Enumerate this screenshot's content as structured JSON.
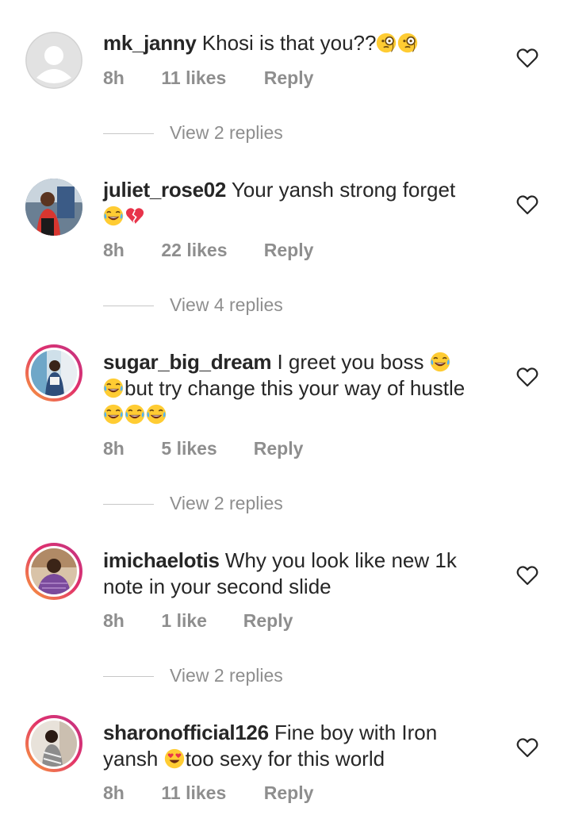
{
  "comments": [
    {
      "username": "mk_janny",
      "text": "Khosi is that you??",
      "emojis_after": [
        "monocle-face",
        "monocle-face"
      ],
      "time": "8h",
      "likes": "11 likes",
      "reply": "Reply",
      "view_replies": "View 2 replies"
    },
    {
      "username": "juliet_rose02",
      "text": "Your yansh strong forget",
      "emojis_line2": [
        "tears-of-joy",
        "broken-heart"
      ],
      "time": "8h",
      "likes": "22 likes",
      "reply": "Reply",
      "view_replies": "View 4 replies"
    },
    {
      "username": "sugar_big_dream",
      "text": "I greet you boss",
      "text2": "but try change this your way of hustle",
      "emojis": [
        "tears-of-joy",
        "tears-of-joy",
        "tears-of-joy",
        "tears-of-joy",
        "tears-of-joy"
      ],
      "time": "8h",
      "likes": "5 likes",
      "reply": "Reply",
      "view_replies": "View 2 replies"
    },
    {
      "username": "imichaelotis",
      "text": "Why you look like new 1k",
      "text2": "note in your second slide",
      "time": "8h",
      "likes": "1 like",
      "reply": "Reply",
      "view_replies": "View 2 replies"
    },
    {
      "username": "sharonofficial126",
      "text": "Fine boy with Iron",
      "text2_a": "yansh",
      "text2_b": "too sexy for this world",
      "emojis": [
        "heart-eyes"
      ],
      "time": "8h",
      "likes": "11 likes",
      "reply": "Reply"
    }
  ],
  "icons": {
    "like": "heart-outline-icon",
    "default_avatar": "default-avatar-icon"
  },
  "colors": {
    "text": "#262626",
    "muted": "#8e8e8e",
    "story_ring_start": "#f9a13a",
    "story_ring_end": "#c13584"
  }
}
